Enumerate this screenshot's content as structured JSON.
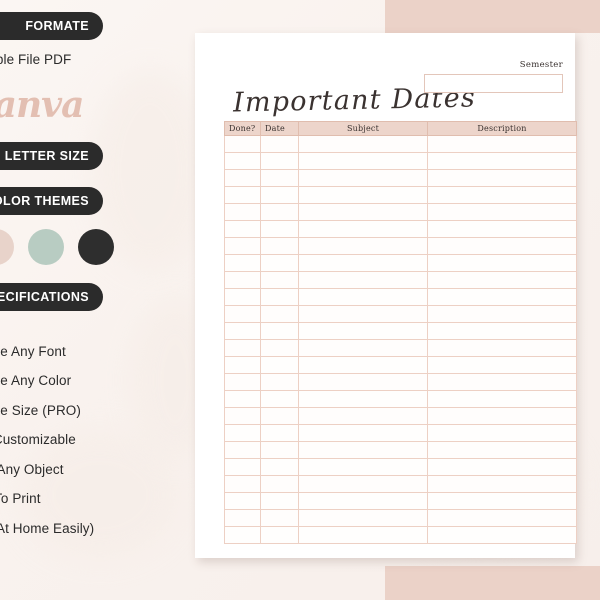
{
  "colors": {
    "accent_pink": "#ebd2c8",
    "table_header_pink": "#edd5cb",
    "table_border_pink": "#edd0c4",
    "pill_dark": "#2b2b2b",
    "swatch_blush": "#e8d3ca",
    "swatch_sage": "#b8ccc2",
    "swatch_charcoal": "#2e2e2e",
    "page_white": "#ffffff",
    "brand_pink": "#e3bfb2"
  },
  "marketing_panel": {
    "pills": [
      {
        "label": "FORMATE"
      },
      {
        "label": "LETTER SIZE"
      },
      {
        "label": "COLOR THEMES"
      },
      {
        "label": "SPECIFICATIONS"
      }
    ],
    "subtitle": "Printable File PDF",
    "brand": "Canva",
    "swatches": [
      {
        "name": "blush",
        "hex": "#e8d3ca"
      },
      {
        "name": "sage",
        "hex": "#b8ccc2"
      },
      {
        "name": "charcoal",
        "hex": "#2e2e2e"
      }
    ],
    "features": [
      "Change Any Font",
      "Change Any Color",
      "Change Size (PRO)",
      "Fully Customizable",
      "Move Any Object",
      "Easy To Print",
      "(Print At Home Easily)"
    ]
  },
  "document": {
    "title": "Important Dates",
    "semester": {
      "label": "Semester",
      "value": "",
      "placeholder": ""
    },
    "table": {
      "columns": [
        "Done?",
        "Date",
        "Subject",
        "Description"
      ],
      "row_count": 24,
      "rows": []
    }
  }
}
